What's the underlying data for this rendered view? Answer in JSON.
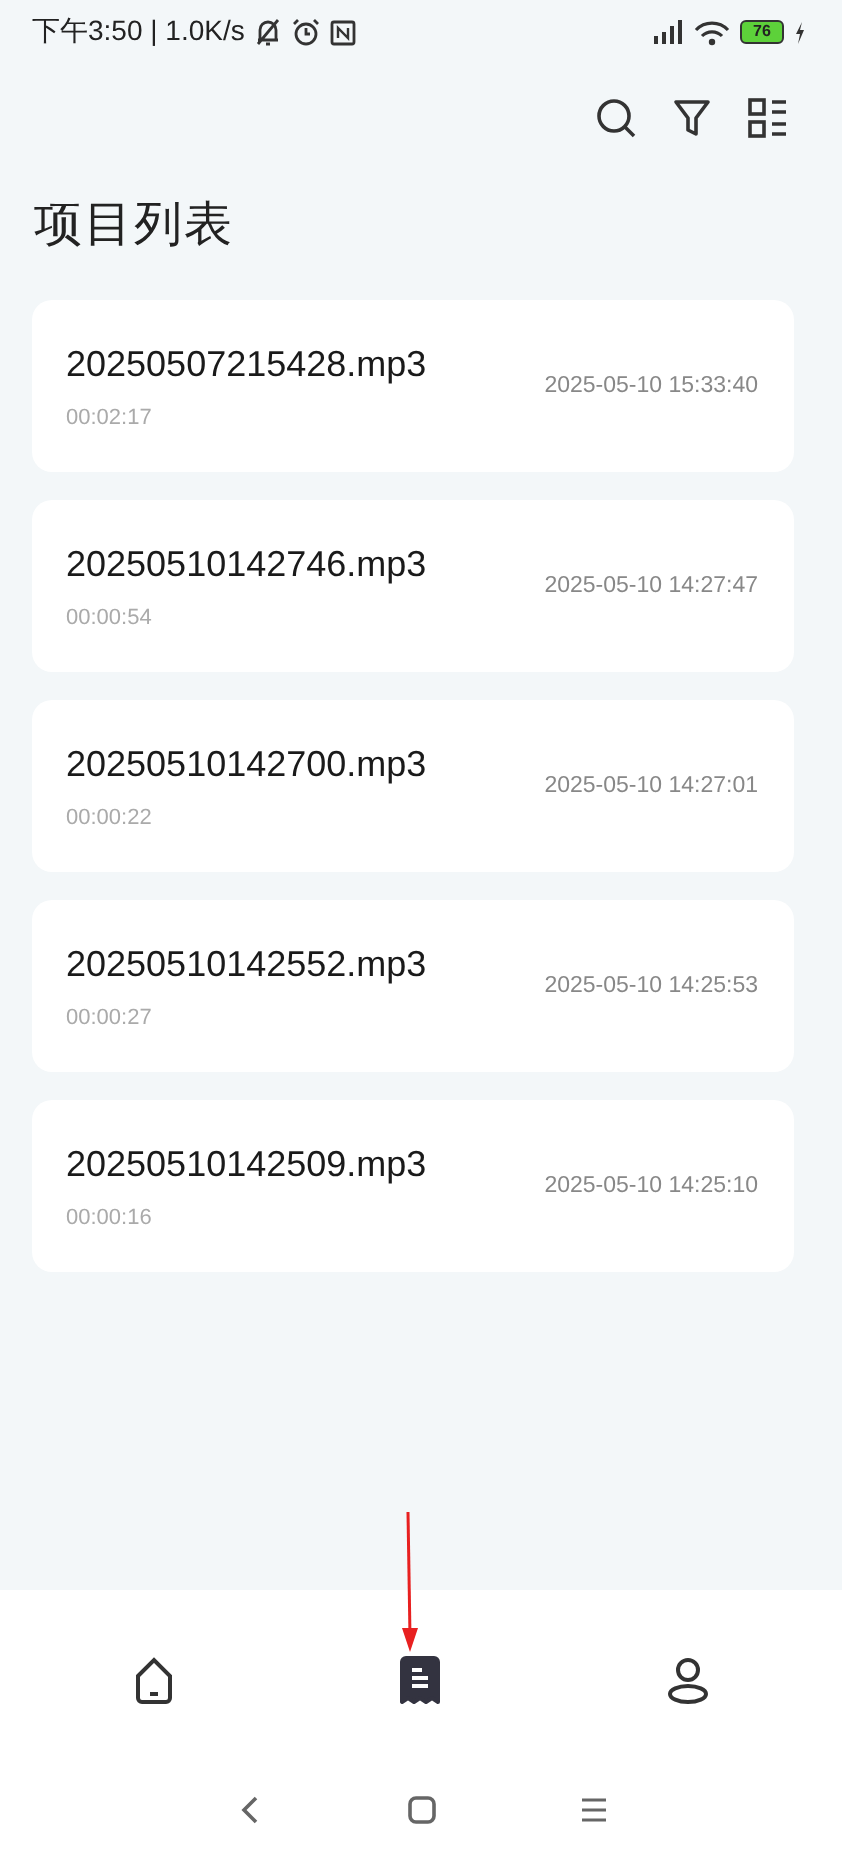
{
  "status_bar": {
    "time": "下午3:50 | 1.0K/s",
    "battery": "76"
  },
  "title": "项目列表",
  "items": [
    {
      "name": "20250507215428.mp3",
      "duration": "00:02:17",
      "date": "2025-05-10 15:33:40"
    },
    {
      "name": "20250510142746.mp3",
      "duration": "00:00:54",
      "date": "2025-05-10 14:27:47"
    },
    {
      "name": "20250510142700.mp3",
      "duration": "00:00:22",
      "date": "2025-05-10 14:27:01"
    },
    {
      "name": "20250510142552.mp3",
      "duration": "00:00:27",
      "date": "2025-05-10 14:25:53"
    },
    {
      "name": "20250510142509.mp3",
      "duration": "00:00:16",
      "date": "2025-05-10 14:25:10"
    }
  ],
  "bottom_nav": [
    {
      "kind": "home",
      "selected": false
    },
    {
      "kind": "list",
      "selected": true
    },
    {
      "kind": "profile",
      "selected": false
    }
  ]
}
